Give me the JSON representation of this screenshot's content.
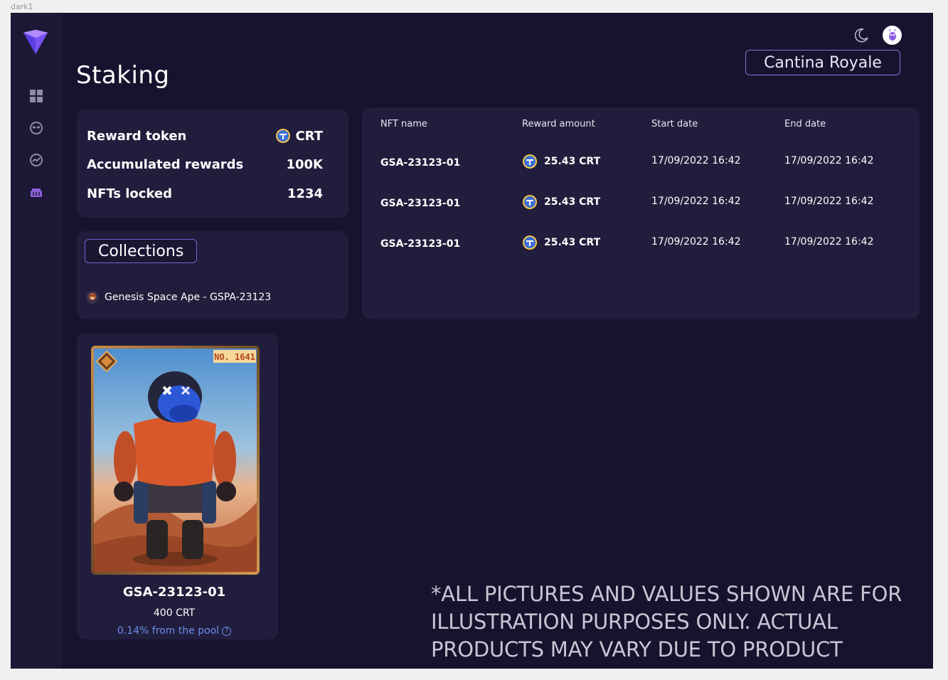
{
  "frame": {
    "label": "dark1"
  },
  "header": {
    "title": "Staking",
    "project_button": "Cantina Royale"
  },
  "sidebar": {
    "items": [
      {
        "name": "dashboard",
        "icon": "grid-icon"
      },
      {
        "name": "alien",
        "icon": "alien-icon"
      },
      {
        "name": "analytics",
        "icon": "chart-line-icon"
      },
      {
        "name": "cart",
        "icon": "basket-icon"
      }
    ]
  },
  "stats": {
    "reward_token_label": "Reward token",
    "reward_token_value": "CRT",
    "accumulated_label": "Accumulated rewards",
    "accumulated_value": "100K",
    "nfts_locked_label": "NFTs locked",
    "nfts_locked_value": "1234"
  },
  "collections": {
    "button_label": "Collections",
    "items": [
      {
        "label": "Genesis Space Ape - GSPA-23123"
      }
    ]
  },
  "table": {
    "headers": [
      "NFT name",
      "Reward amount",
      "Start date",
      "End date"
    ],
    "rows": [
      {
        "name": "GSA-23123-01",
        "reward": "25.43 CRT",
        "start": "17/09/2022 16:42",
        "end": "17/09/2022 16:42"
      },
      {
        "name": "GSA-23123-01",
        "reward": "25.43 CRT",
        "start": "17/09/2022 16:42",
        "end": "17/09/2022 16:42"
      },
      {
        "name": "GSA-23123-01",
        "reward": "25.43 CRT",
        "start": "17/09/2022 16:42",
        "end": "17/09/2022 16:42"
      }
    ]
  },
  "nft": {
    "badge": "NO. 1641",
    "name": "GSA-23123-01",
    "reward": "400 CRT",
    "share": "0.14% from the pool"
  },
  "disclaimer": "*ALL PICTURES AND VALUES SHOWN ARE FOR ILLUSTRATION PURPOSES ONLY. ACTUAL PRODUCTS MAY VARY DUE TO PRODUCT ENHANCEMENT.",
  "colors": {
    "background": "#16132e",
    "sidebar": "#1c1836",
    "card": "#211d3c",
    "accent": "#8b6fd6",
    "link": "#6c8df0"
  }
}
